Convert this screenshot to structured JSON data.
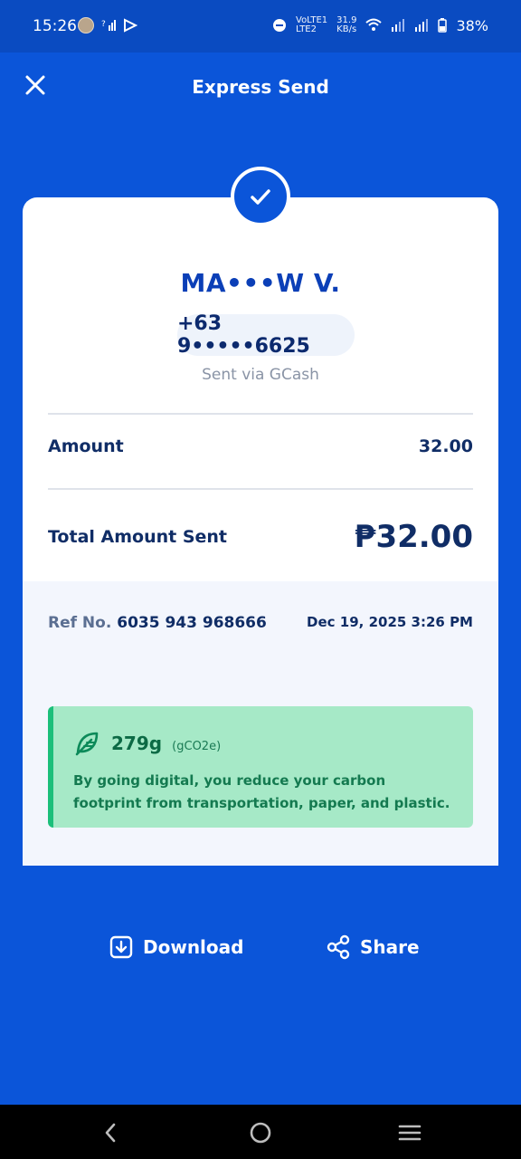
{
  "status": {
    "time": "15:26",
    "volte": "VoLTE1",
    "lte2": "LTE2",
    "speed_value": "31.9",
    "speed_unit": "KB/s",
    "battery": "38%"
  },
  "header": {
    "title": "Express Send"
  },
  "receipt": {
    "recipient_name": "MA•••W V.",
    "phone": "+63 9•••••6625",
    "sent_via": "Sent via GCash",
    "amount_label": "Amount",
    "amount_value": "32.00",
    "total_label": "Total Amount Sent",
    "total_value": "₱32.00",
    "ref_label": "Ref No.",
    "ref_number": "6035 943 968666",
    "date_time": "Dec 19, 2025 3:26 PM"
  },
  "eco": {
    "grams": "279g",
    "unit": "(gCO2e)",
    "description": "By going digital, you reduce your carbon footprint from transportation, paper, and plastic."
  },
  "actions": {
    "download": "Download",
    "share": "Share"
  },
  "colors": {
    "brand_blue": "#0b55d9",
    "eco_green": "#a6e9c7"
  },
  "icons": [
    "close-icon",
    "check-icon",
    "leaf-icon",
    "download-icon",
    "share-icon",
    "back-icon",
    "home-icon",
    "menu-icon"
  ]
}
